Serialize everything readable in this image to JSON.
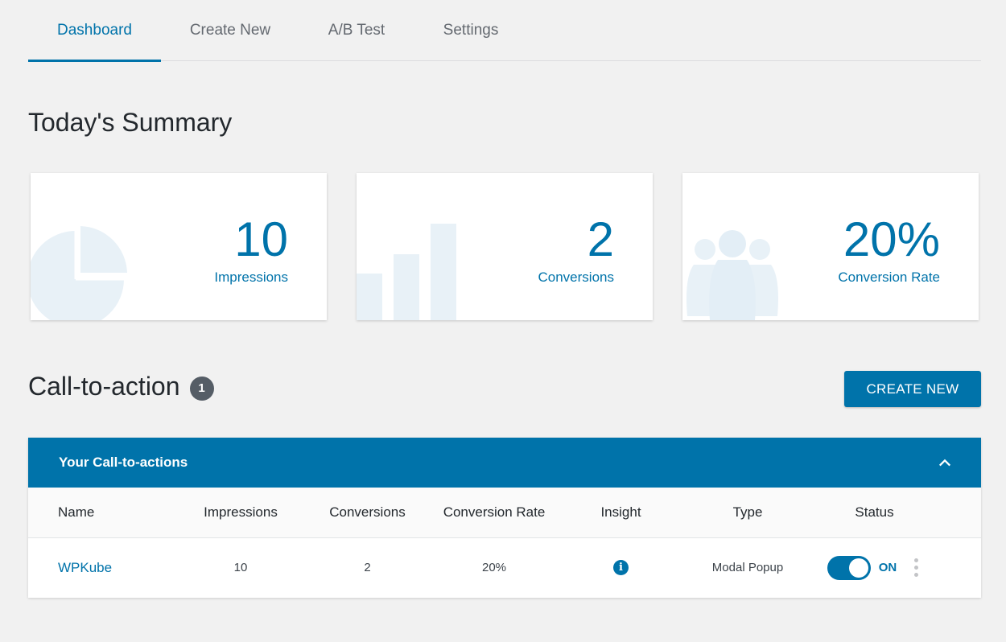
{
  "tabs": [
    {
      "label": "Dashboard",
      "active": true
    },
    {
      "label": "Create New",
      "active": false
    },
    {
      "label": "A/B Test",
      "active": false
    },
    {
      "label": "Settings",
      "active": false
    }
  ],
  "summary": {
    "title": "Today's Summary",
    "cards": [
      {
        "value": "10",
        "label": "Impressions",
        "icon": "pie-chart-icon"
      },
      {
        "value": "2",
        "label": "Conversions",
        "icon": "bar-chart-icon"
      },
      {
        "value": "20%",
        "label": "Conversion Rate",
        "icon": "users-icon"
      }
    ]
  },
  "cta": {
    "title": "Call-to-action",
    "count": "1",
    "create_label": "CREATE NEW"
  },
  "panel": {
    "title": "Your Call-to-actions",
    "columns": [
      "Name",
      "Impressions",
      "Conversions",
      "Conversion Rate",
      "Insight",
      "Type",
      "Status"
    ],
    "rows": [
      {
        "name": "WPKube",
        "impressions": "10",
        "conversions": "2",
        "rate": "20%",
        "type": "Modal Popup",
        "status": "ON"
      }
    ]
  },
  "colors": {
    "accent": "#0073aa",
    "background": "#f1f1f1",
    "badge": "#555d66"
  }
}
